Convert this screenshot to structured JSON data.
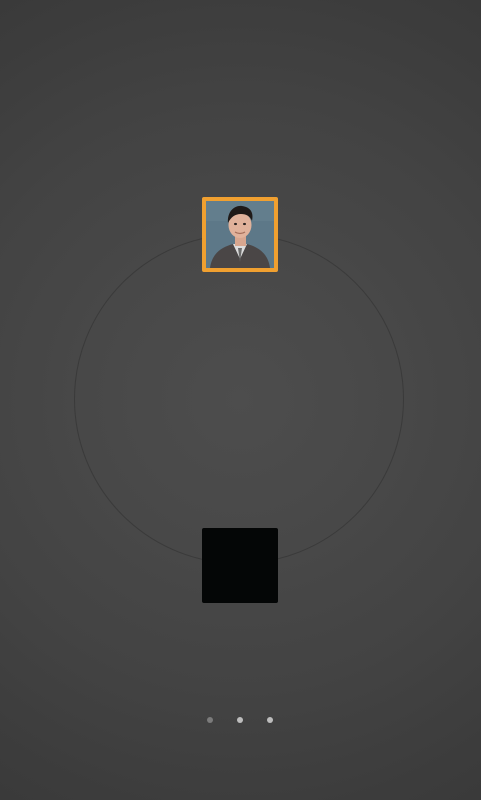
{
  "screen": {
    "name": "circular-contact-carousel"
  },
  "tiles": [
    {
      "id": "avatar-tile",
      "type": "photo",
      "highlight_color": "#f0a030",
      "description_icon": "person-photo"
    },
    {
      "id": "empty-tile",
      "type": "empty",
      "fill_color": "#040606"
    }
  ],
  "pager": {
    "page_count": 3,
    "active_indicators": [
      2,
      3
    ],
    "dim_color": "#7b7b7b",
    "active_color": "#bdbdbd"
  },
  "colors": {
    "background_center": "#4d4d4d",
    "background_edge": "#363636",
    "ring": "#3a3a3a"
  }
}
